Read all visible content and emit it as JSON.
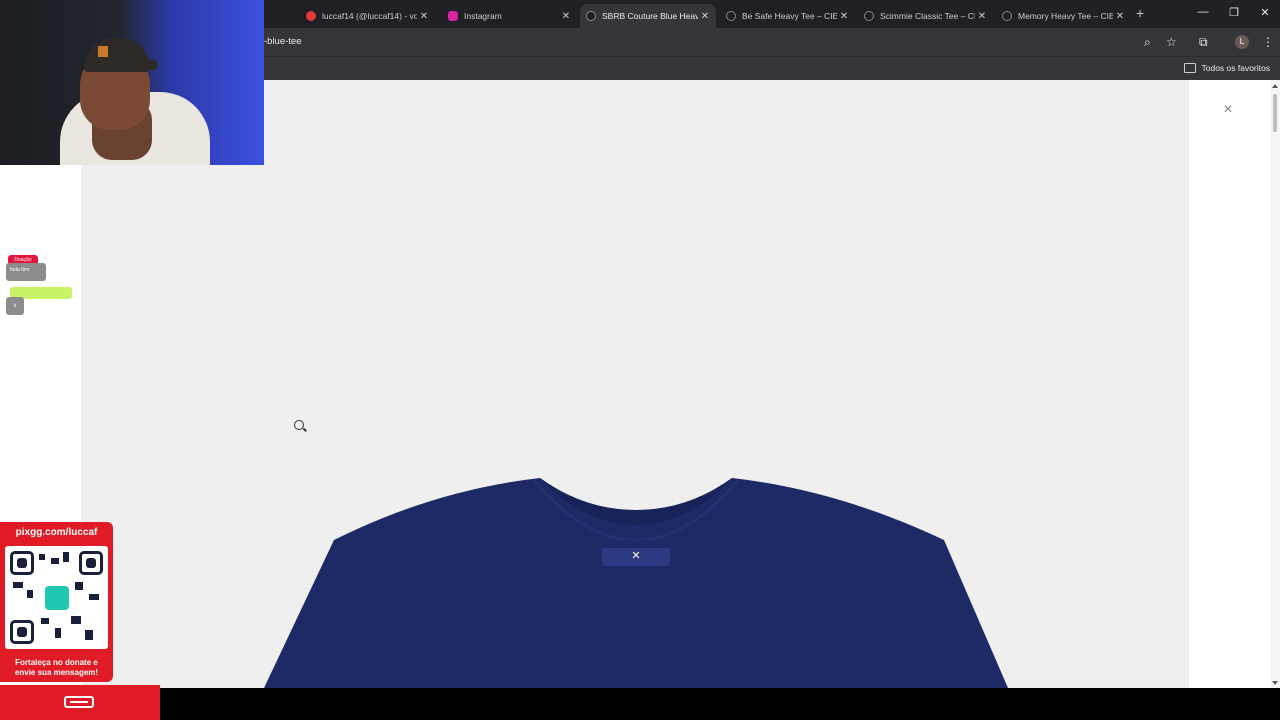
{
  "browser": {
    "tabs": [
      {
        "title": "luccaf14 (@luccaf14) - vo",
        "favicon_color": "#e53935",
        "active": false
      },
      {
        "title": "Instagram",
        "favicon_color": "#d6249f",
        "active": false
      },
      {
        "title": "SBRB Couture Blue Heavy",
        "favicon_color": "#1f1f1f",
        "active": true
      },
      {
        "title": "Be Safe Heavy Tee – CIEN",
        "favicon_color": "#1f1f1f",
        "active": false
      },
      {
        "title": "Scimmie Classic Tee – CIE",
        "favicon_color": "#1f1f1f",
        "active": false
      },
      {
        "title": "Memory Heavy Tee – CIEN",
        "favicon_color": "#1f1f1f",
        "active": false
      }
    ],
    "url_visible": "-blue-tee",
    "profile_initial": "L",
    "bookmarks_all_label": "Todos os favoritos"
  },
  "viewer": {
    "close_symbol": "×",
    "tee_color": "#1d2a66",
    "background": "#efefef"
  },
  "overlays": {
    "chat_badge": "Doação",
    "chat_text": "foda tbm",
    "donate_url": "pixgg.com/luccaf",
    "donate_message_line1": "Fortaleça no donate e",
    "donate_message_line2": "envie sua mensagem!"
  },
  "colors": {
    "accent_red": "#e11b25",
    "chrome_dark": "#202124",
    "chrome_mid": "#35363a"
  }
}
